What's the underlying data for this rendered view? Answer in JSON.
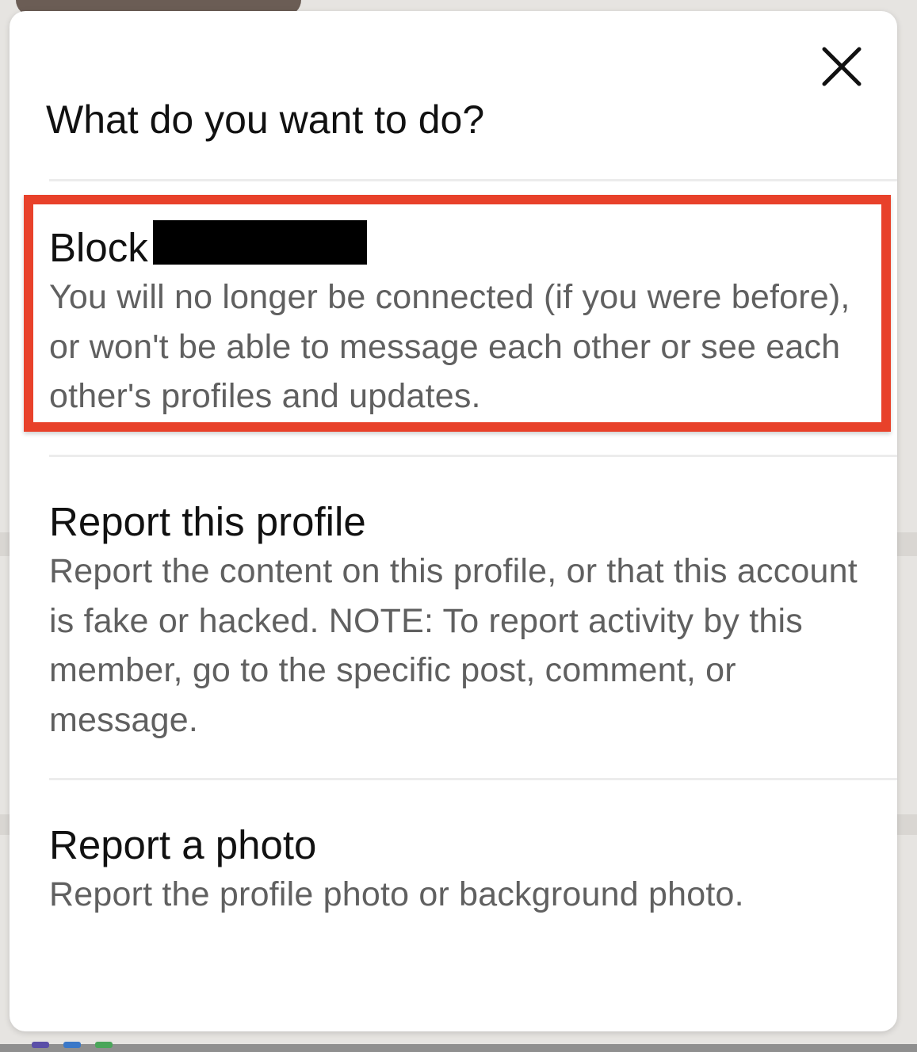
{
  "dialog": {
    "title": "What do you want to do?",
    "close_icon": "close-icon"
  },
  "options": [
    {
      "title": "Block",
      "description": "You will no longer be connected (if you were before), or won't be able to message each other or see each other's profiles and updates."
    },
    {
      "title": "Report this profile",
      "description": "Report the content on this profile, or that this account is fake or hacked. NOTE: To report activity by this member, go to the specific post, comment, or message."
    },
    {
      "title": "Report a photo",
      "description": "Report the profile photo or background photo."
    }
  ],
  "colors": {
    "highlight": "#e8412a",
    "title_text": "#111111",
    "description_text": "#606060",
    "divider": "#ececec",
    "modal_bg": "#ffffff"
  }
}
